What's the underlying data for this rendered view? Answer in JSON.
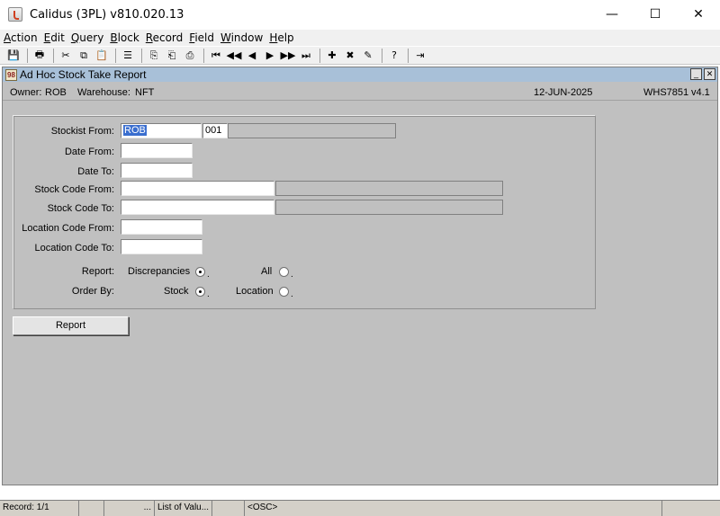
{
  "window": {
    "title": "Calidus (3PL) v810.020.13",
    "minimize": "—",
    "maximize": "☐",
    "close": "✕"
  },
  "menu": [
    {
      "label_u": "A",
      "label_rest": "ction"
    },
    {
      "label_u": "E",
      "label_rest": "dit"
    },
    {
      "label_u": "Q",
      "label_rest": "uery"
    },
    {
      "label_u": "B",
      "label_rest": "lock"
    },
    {
      "label_u": "R",
      "label_rest": "ecord"
    },
    {
      "label_u": "F",
      "label_rest": "ield"
    },
    {
      "label_u": "W",
      "label_rest": "indow"
    },
    {
      "label_u": "H",
      "label_rest": "elp"
    }
  ],
  "toolbar": {
    "save": "💾",
    "print": "🖶",
    "cut": "✂",
    "copy": "⧉",
    "paste": "📋",
    "clear": "☰",
    "dup1": "⎘",
    "dup2": "⎗",
    "dup3": "⎙",
    "first": "⏮",
    "prev_set": "◀◀",
    "prev": "◀",
    "next": "▶",
    "next_set": "▶▶",
    "last": "⏭",
    "insert": "✚",
    "delete": "✖",
    "edit": "✎",
    "help": "?",
    "exit": "⇥"
  },
  "form": {
    "title": "Ad Hoc Stock Take Report",
    "icon_text": "98",
    "owner_label": "Owner:",
    "owner_value": "ROB",
    "warehouse_label": "Warehouse:",
    "warehouse_value": "NFT",
    "date": "12-JUN-2025",
    "form_id": "WHS7851",
    "version": "v4.1",
    "min_btn": "_",
    "close_btn": "✕"
  },
  "fields": {
    "stockist_from_label": "Stockist From:",
    "stockist_from_value": "ROB",
    "stockist_from_code": "001",
    "stockist_from_desc": "",
    "date_from_label": "Date From:",
    "date_from_value": "",
    "date_to_label": "Date To:",
    "date_to_value": "",
    "stock_code_from_label": "Stock Code From:",
    "stock_code_from_value": "",
    "stock_code_from_desc": "",
    "stock_code_to_label": "Stock Code To:",
    "stock_code_to_value": "",
    "stock_code_to_desc": "",
    "location_code_from_label": "Location Code From:",
    "location_code_from_value": "",
    "location_code_to_label": "Location Code To:",
    "location_code_to_value": ""
  },
  "options": {
    "report_label": "Report:",
    "discrepancies": "Discrepancies",
    "all": "All",
    "order_by_label": "Order By:",
    "stock": "Stock",
    "location": "Location",
    "dot": "."
  },
  "buttons": {
    "report": "Report"
  },
  "status": {
    "record": "Record: 1/1",
    "s2": "",
    "s3": "...",
    "s4": "List of Valu...",
    "s5": "",
    "s6": "<OSC>",
    "s7": ""
  }
}
